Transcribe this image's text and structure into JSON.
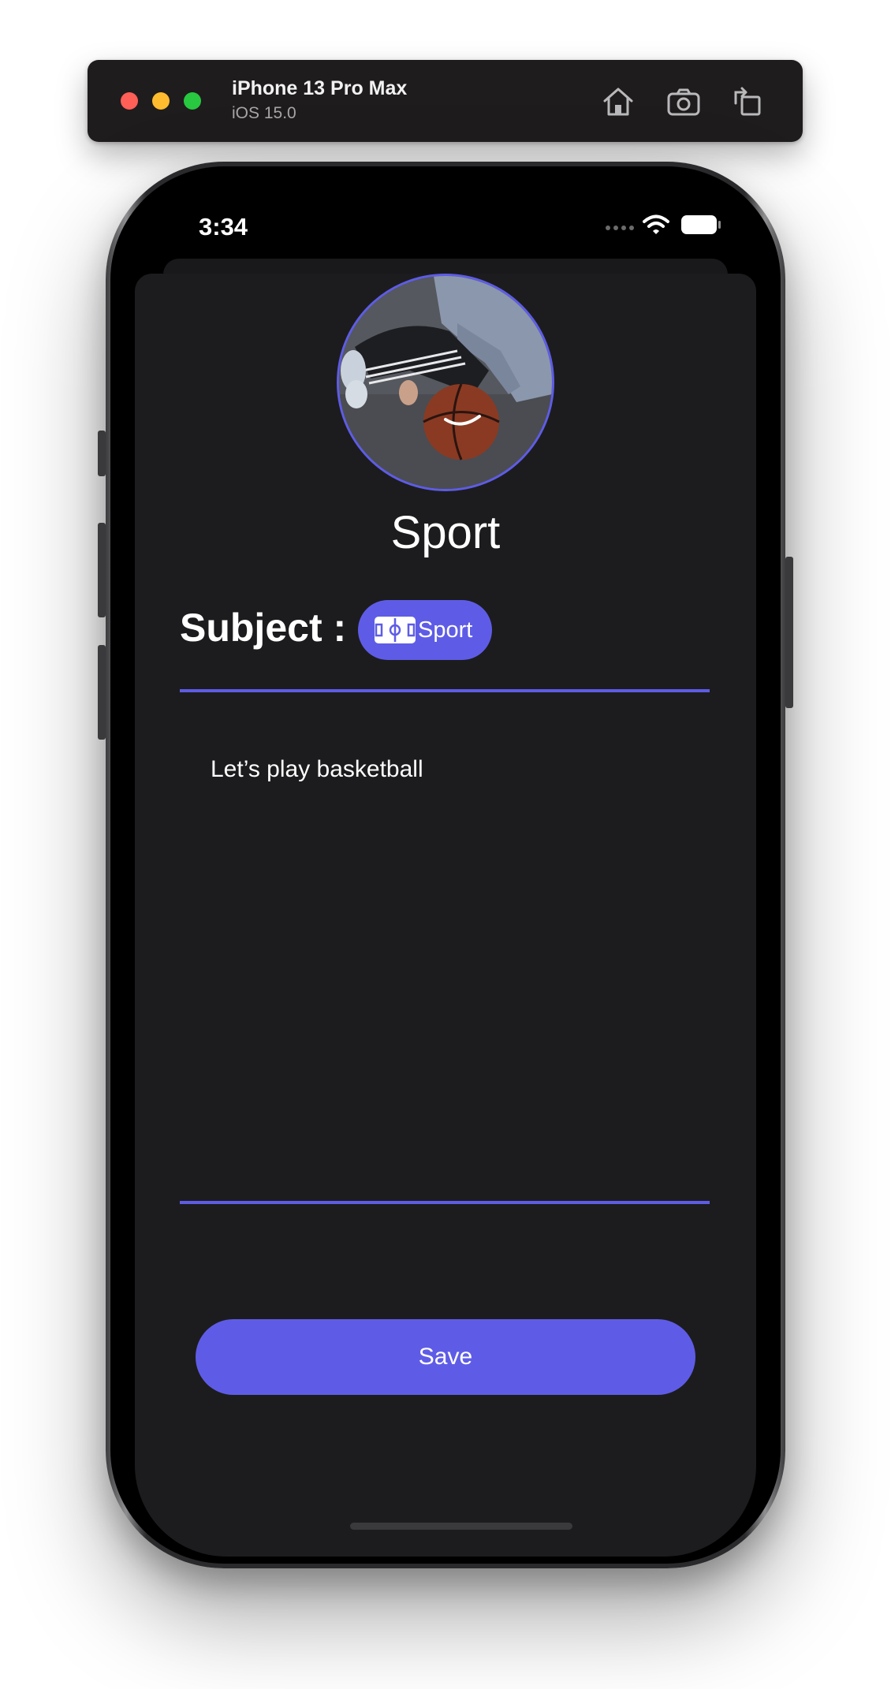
{
  "simulator": {
    "device_name": "iPhone 13 Pro Max",
    "os_version": "iOS 15.0",
    "buttons": [
      {
        "icon": "home-icon"
      },
      {
        "icon": "camera-icon"
      },
      {
        "icon": "rotate-icon"
      }
    ]
  },
  "status_bar": {
    "time": "3:34",
    "icons": [
      "signal-dots-icon",
      "wifi-icon",
      "battery-icon"
    ]
  },
  "sheet": {
    "avatar_icon": "basketball-photo",
    "title": "Sport",
    "subject_label": "Subject :",
    "subject_chip": {
      "icon": "sports-court-icon",
      "label": "Sport"
    },
    "note_text": "Let’s play basketball",
    "save_label": "Save"
  },
  "colors": {
    "accent": "#5e5ce6",
    "sheet_background": "#1c1c1e",
    "screen_background": "#000000",
    "text": "#ffffff"
  }
}
